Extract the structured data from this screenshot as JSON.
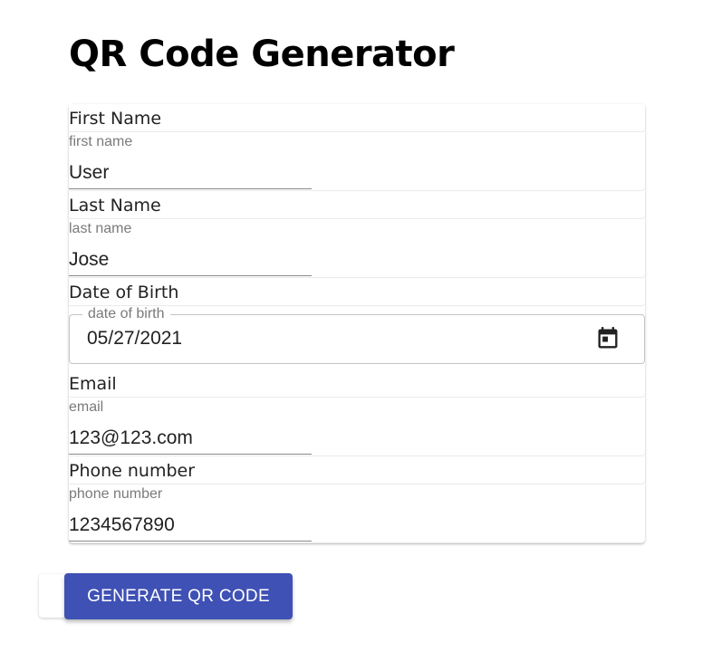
{
  "page": {
    "title": "QR Code Generator"
  },
  "form": {
    "first_name": {
      "label": "First Name",
      "caption": "first name",
      "value": "User"
    },
    "last_name": {
      "label": "Last Name",
      "caption": "last name",
      "value": "Jose"
    },
    "dob": {
      "label": "Date of Birth",
      "caption": "date of birth",
      "value": "05/27/2021",
      "icon": "calendar-icon"
    },
    "email": {
      "label": "Email",
      "caption": "email",
      "value": "123@123.com"
    },
    "phone": {
      "label": "Phone number",
      "caption": "phone number",
      "value": "1234567890"
    }
  },
  "actions": {
    "generate_label": "GENERATE QR CODE"
  },
  "colors": {
    "primary": "#3f51b5",
    "text": "#222222",
    "caption": "#7a7a7a"
  }
}
